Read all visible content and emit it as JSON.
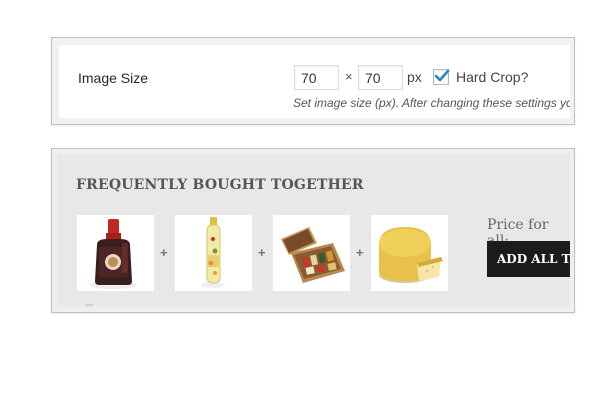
{
  "settings": {
    "label": "Image Size",
    "width_value": "70",
    "height_value": "70",
    "separator": "×",
    "unit": "px",
    "hard_crop": {
      "checked": true,
      "label": "Hard Crop?"
    },
    "hint": "Set image size (px). After changing these settings you"
  },
  "fbt": {
    "title": "FREQUENTLY BOUGHT TOGETHER",
    "products": [
      {
        "icon": "balsamic-vinegar-bottle-icon"
      },
      {
        "icon": "pepper-oil-bottle-icon"
      },
      {
        "icon": "gourmet-gift-box-icon"
      },
      {
        "icon": "cheese-wheel-icon"
      }
    ],
    "plus": "+",
    "price_label": "Price for all:",
    "button_label": "ADD ALL TO"
  },
  "colors": {
    "checkbox_check": "#1e8cbe",
    "button_bg": "#1c1c1c",
    "card_bg": "#e8e8e8"
  }
}
